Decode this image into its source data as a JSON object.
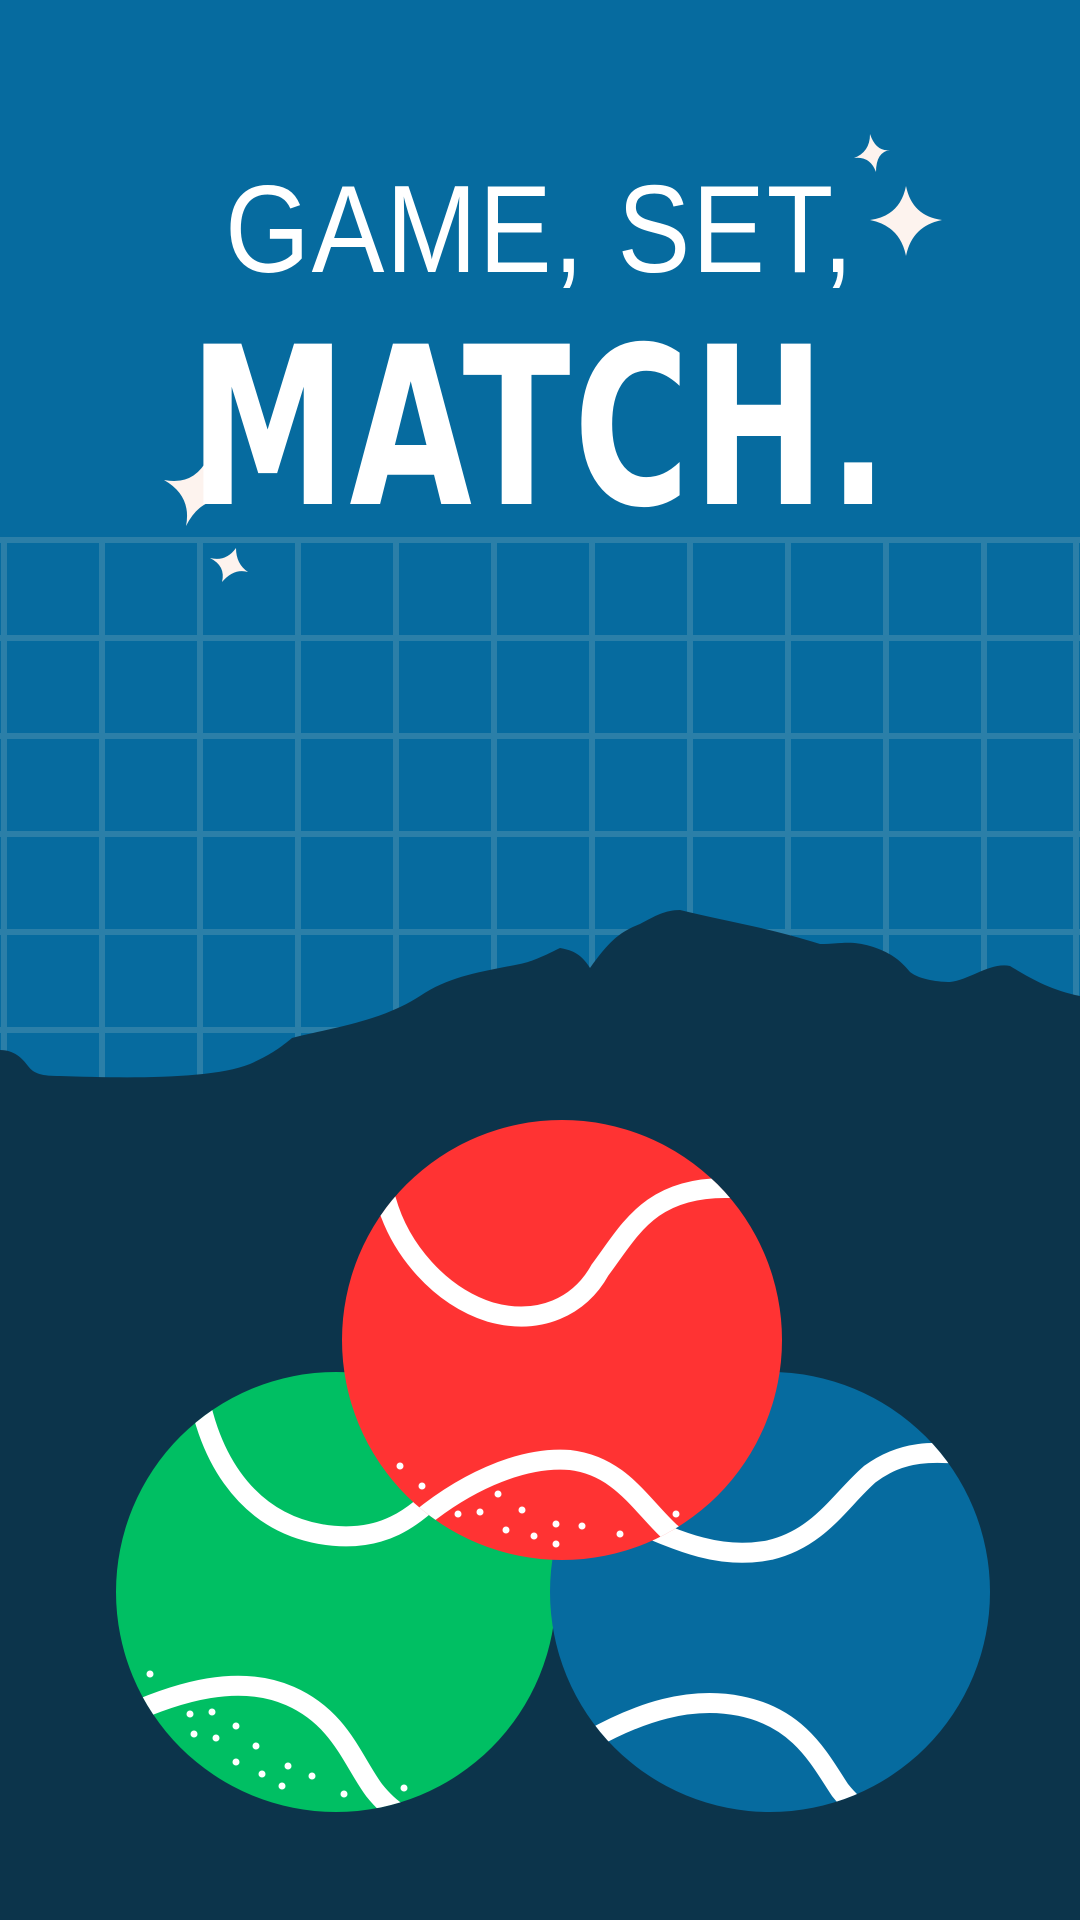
{
  "poster": {
    "headline_line1": "GAME, SET,",
    "headline_line2": "MATCH."
  },
  "colors": {
    "background": "#066b9f",
    "net_line": "#2b7fa8",
    "ground": "#0c344b",
    "ball_red": "#ff3333",
    "ball_green": "#00bf63",
    "ball_blue": "#066b9f",
    "seam": "#ffffff",
    "sparkle": "#fdf3ee"
  },
  "icons": [
    "sparkle-icon",
    "tennis-ball-icon"
  ]
}
